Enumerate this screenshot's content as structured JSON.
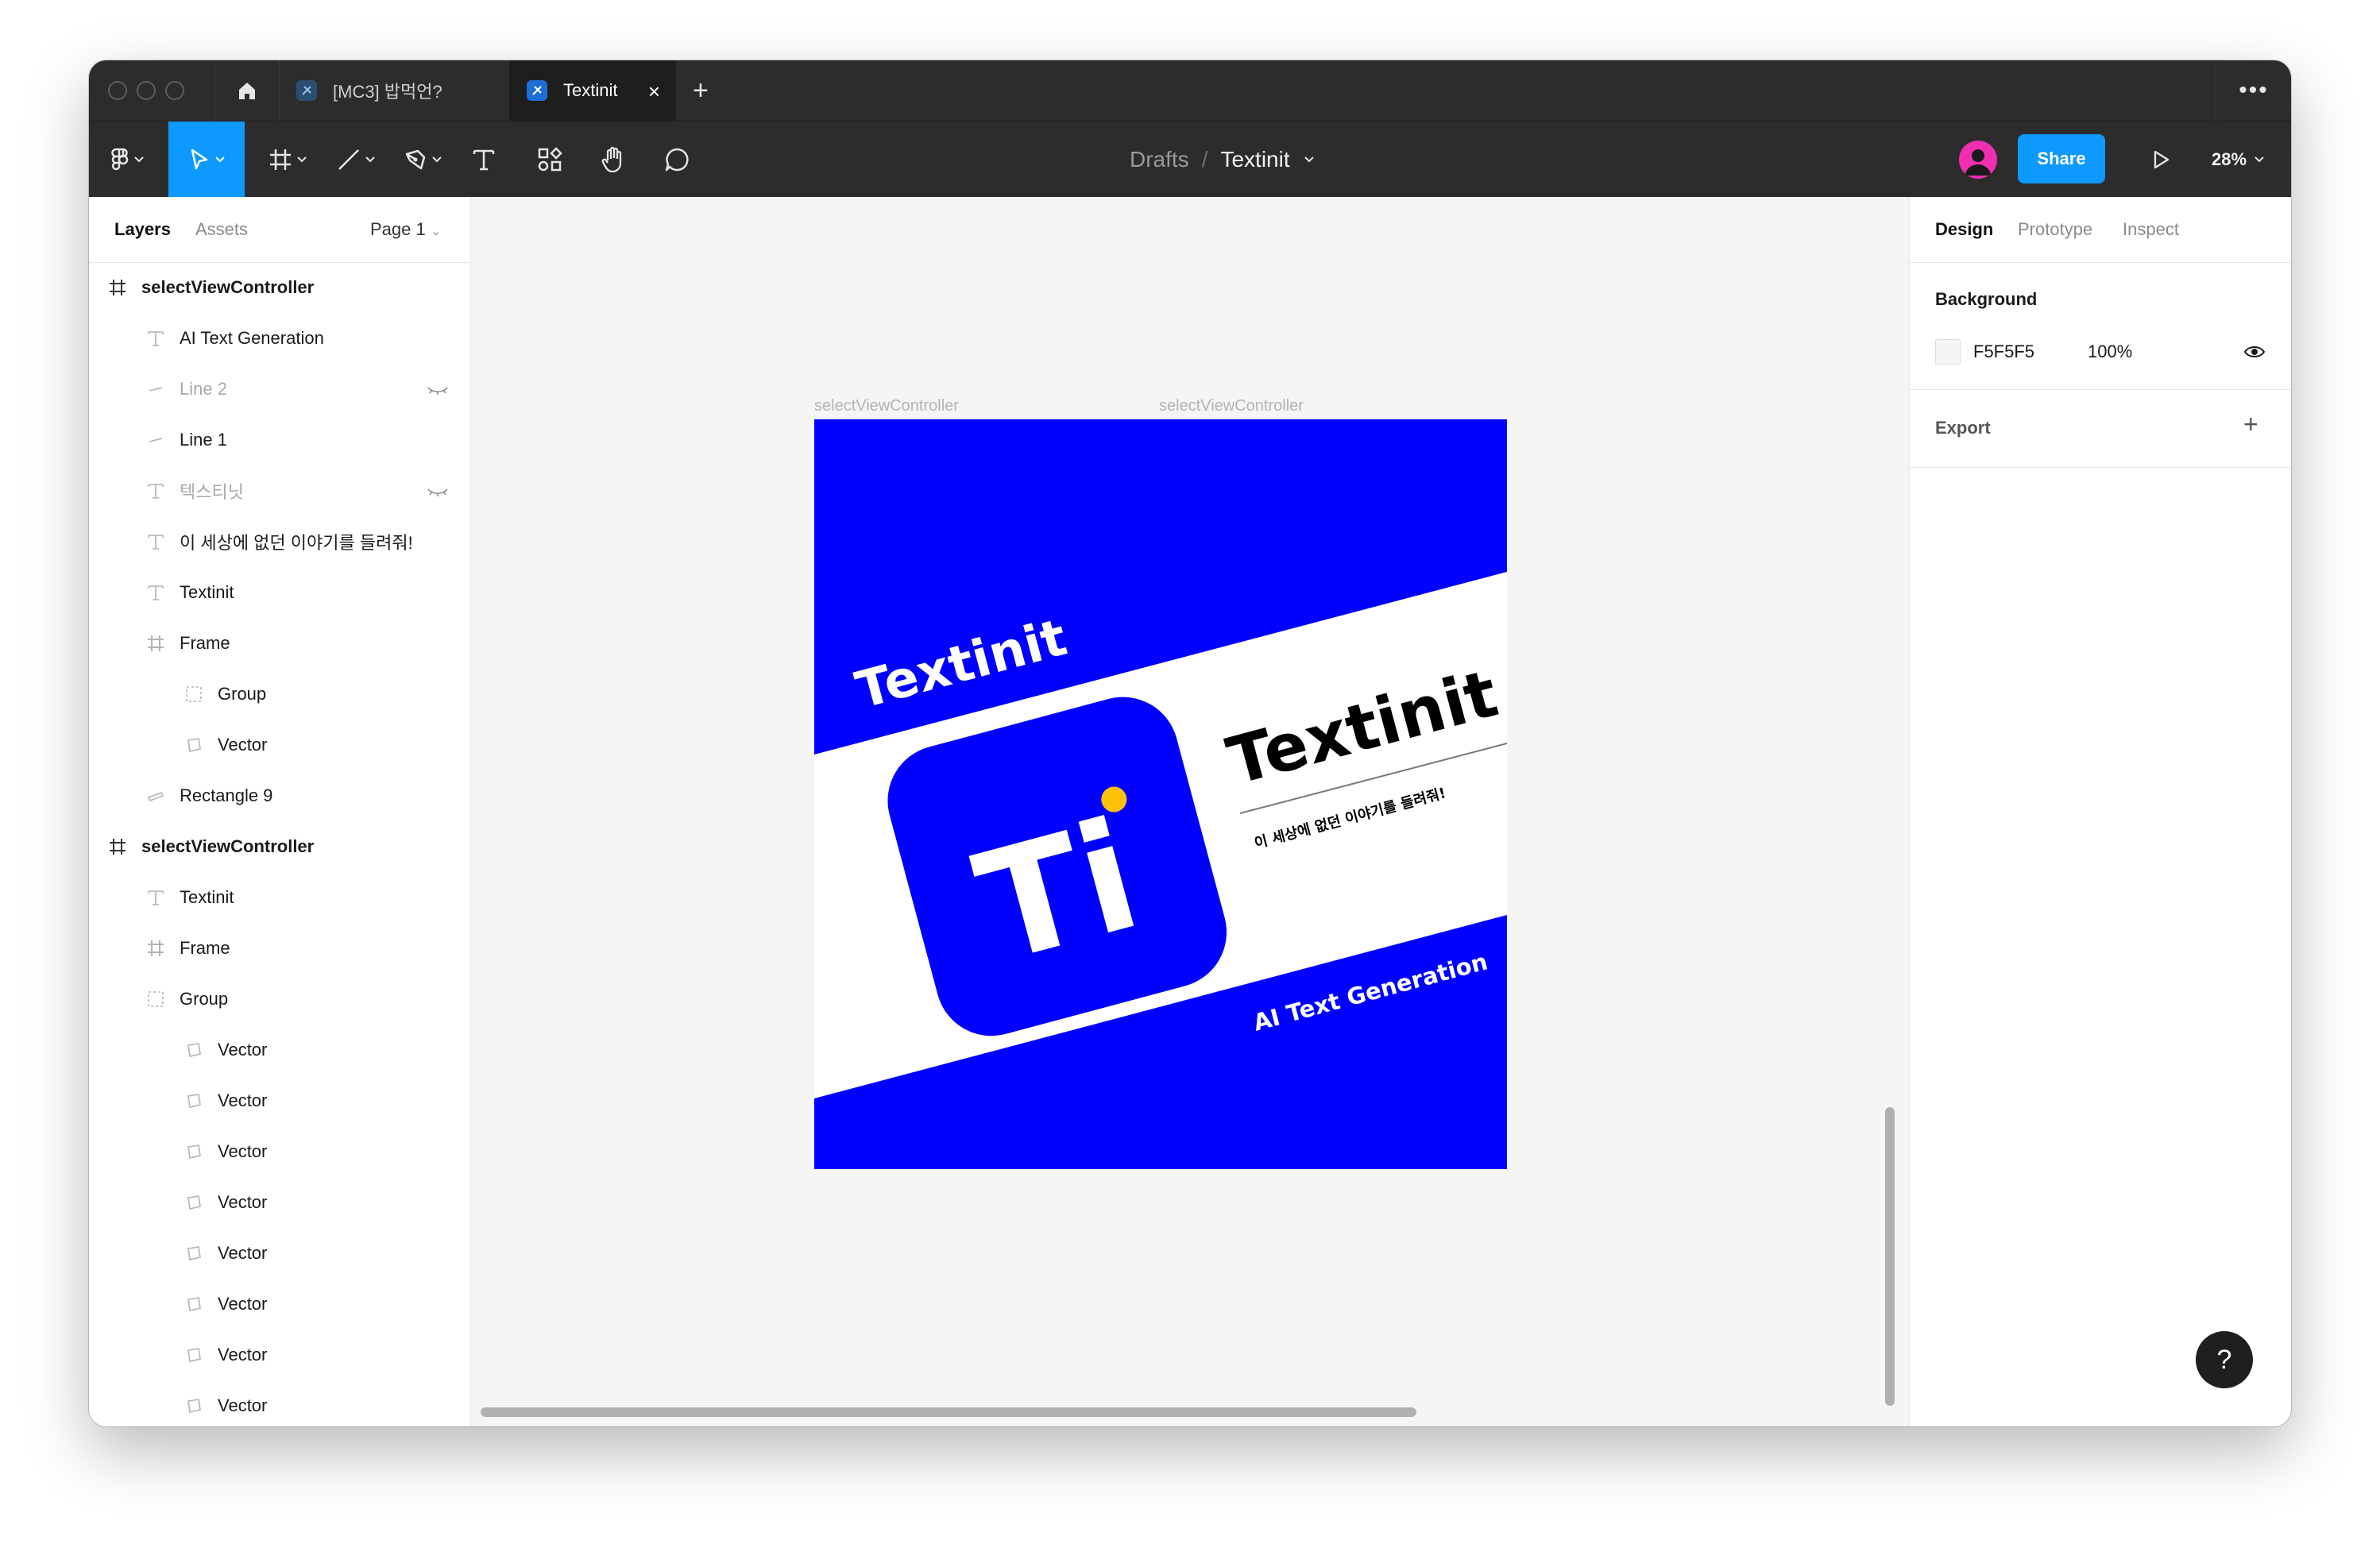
{
  "window": {
    "tabs": [
      {
        "label": "[MC3] 밥먹언?"
      },
      {
        "label": "Textinit"
      }
    ],
    "new_tab_symbol": "+",
    "more_symbol": "•••"
  },
  "toolbar": {
    "tools": [
      "figma-menu-icon",
      "move-icon",
      "frame-icon",
      "line-icon",
      "pen-icon",
      "text-icon",
      "components-icon",
      "hand-icon",
      "comment-icon"
    ],
    "active_tool": "move-icon",
    "breadcrumb_root": "Drafts",
    "breadcrumb_sep": "/",
    "file_name": "Textinit",
    "share_label": "Share",
    "zoom": "28%",
    "accent": "#0d99ff"
  },
  "left_panel": {
    "tabs": [
      "Layers",
      "Assets"
    ],
    "page": "Page 1",
    "layers": [
      {
        "name": "selectViewController",
        "icon": "frame-icon",
        "depth": 0,
        "hidden": false
      },
      {
        "name": "AI Text Generation",
        "icon": "text-icon",
        "depth": 1,
        "hidden": false
      },
      {
        "name": "Line 2",
        "icon": "line-icon",
        "depth": 1,
        "hidden": true
      },
      {
        "name": "Line 1",
        "icon": "line-icon",
        "depth": 1,
        "hidden": false
      },
      {
        "name": "텍스티닛",
        "icon": "text-icon",
        "depth": 1,
        "hidden": true
      },
      {
        "name": "이 세상에 없던 이야기를 들려줘!",
        "icon": "text-icon",
        "depth": 1,
        "hidden": false
      },
      {
        "name": "Textinit",
        "icon": "text-icon",
        "depth": 1,
        "hidden": false
      },
      {
        "name": "Frame",
        "icon": "frame-icon",
        "depth": 1,
        "hidden": false
      },
      {
        "name": "Group",
        "icon": "group-icon",
        "depth": 2,
        "hidden": false
      },
      {
        "name": "Vector",
        "icon": "vector-icon",
        "depth": 2,
        "hidden": false
      },
      {
        "name": "Rectangle 9",
        "icon": "rectangle-icon",
        "depth": 1,
        "hidden": false
      },
      {
        "name": "selectViewController",
        "icon": "frame-icon",
        "depth": 0,
        "hidden": false
      },
      {
        "name": "Textinit",
        "icon": "text-icon",
        "depth": 1,
        "hidden": false
      },
      {
        "name": "Frame",
        "icon": "frame-icon",
        "depth": 1,
        "hidden": false
      },
      {
        "name": "Group",
        "icon": "group-icon",
        "depth": 1,
        "hidden": false
      },
      {
        "name": "Vector",
        "icon": "vector-icon",
        "depth": 2,
        "hidden": false
      },
      {
        "name": "Vector",
        "icon": "vector-icon",
        "depth": 2,
        "hidden": false
      },
      {
        "name": "Vector",
        "icon": "vector-icon",
        "depth": 2,
        "hidden": false
      },
      {
        "name": "Vector",
        "icon": "vector-icon",
        "depth": 2,
        "hidden": false
      },
      {
        "name": "Vector",
        "icon": "vector-icon",
        "depth": 2,
        "hidden": false
      },
      {
        "name": "Vector",
        "icon": "vector-icon",
        "depth": 2,
        "hidden": false
      },
      {
        "name": "Vector",
        "icon": "vector-icon",
        "depth": 2,
        "hidden": false
      },
      {
        "name": "Vector",
        "icon": "vector-icon",
        "depth": 2,
        "hidden": false
      }
    ]
  },
  "canvas": {
    "frame_labels": [
      "selectViewController",
      "selectViewController"
    ],
    "artboard": {
      "background": "#0000ff",
      "headline_top": "Textinit",
      "logo_text": "Ti",
      "brand_title": "Textinit",
      "tagline": "이 세상에 없던 이야기를 들려줘!",
      "bottom_text": "AI Text Generation",
      "accent_yellow": "#ffc107"
    }
  },
  "right_panel": {
    "tabs": [
      "Design",
      "Prototype",
      "Inspect"
    ],
    "background_title": "Background",
    "background_hex": "F5F5F5",
    "background_opacity": "100%",
    "export_title": "Export",
    "export_add": "+"
  },
  "help_symbol": "?"
}
